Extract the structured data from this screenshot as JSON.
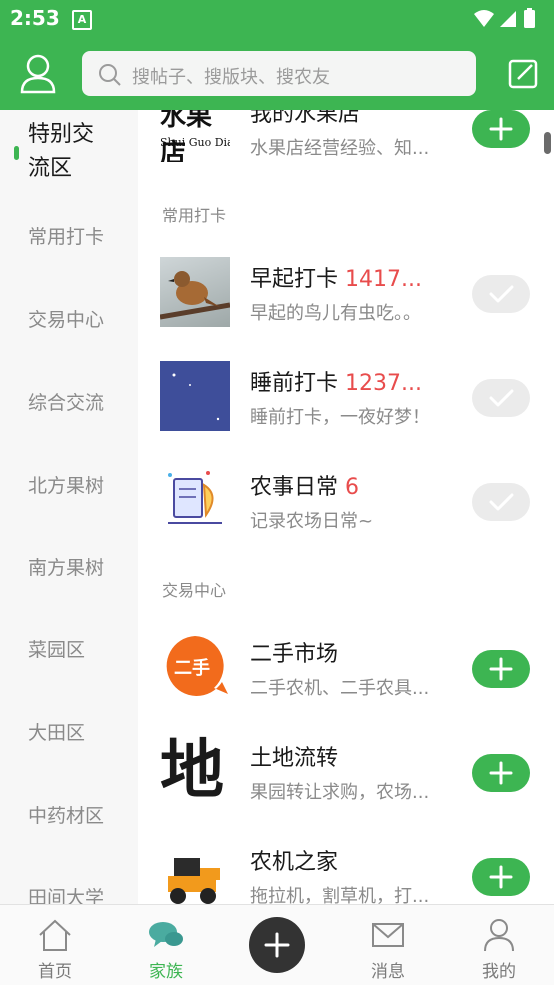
{
  "status_bar": {
    "time": "2:53",
    "notification_glyph": "A"
  },
  "search": {
    "placeholder": "搜帖子、搜版块、搜农友"
  },
  "sidebar": {
    "items": [
      {
        "label": "特别交\n流区",
        "active": true
      },
      {
        "label": "常用打卡"
      },
      {
        "label": "交易中心"
      },
      {
        "label": "综合交流"
      },
      {
        "label": "北方果树"
      },
      {
        "label": "南方果树"
      },
      {
        "label": "菜园区"
      },
      {
        "label": "大田区"
      },
      {
        "label": "中药材区"
      },
      {
        "label": "田间大学"
      }
    ]
  },
  "content": {
    "partial_top": {
      "title": "我的水果店",
      "desc": "水果店经营经验、知...",
      "thumb_text_cn": "水果店",
      "thumb_text_en": "Shui Guo Dian",
      "action": "add"
    },
    "sections": [
      {
        "header": "常用打卡",
        "items": [
          {
            "title": "早起打卡",
            "count": "1417...",
            "desc": "早起的鸟儿有虫吃。。",
            "action": "done"
          },
          {
            "title": "睡前打卡",
            "count": "1237...",
            "desc": "睡前打卡，一夜好梦！",
            "action": "done"
          },
          {
            "title": "农事日常",
            "count": "6",
            "desc": "记录农场日常~",
            "action": "done"
          }
        ]
      },
      {
        "header": "交易中心",
        "items": [
          {
            "title": "二手市场",
            "count": "",
            "desc": "二手农机、二手农具...",
            "thumb_text": "二手",
            "action": "add"
          },
          {
            "title": "土地流转",
            "count": "",
            "desc": "果园转让求购，农场...",
            "thumb_text": "地",
            "action": "add"
          },
          {
            "title": "农机之家",
            "count": "",
            "desc": "拖拉机，割草机，打...",
            "action": "add"
          }
        ]
      }
    ]
  },
  "tabbar": {
    "tabs": [
      {
        "label": "首页",
        "icon": "home-icon"
      },
      {
        "label": "家族",
        "icon": "chat-bubbles-icon",
        "active": true
      },
      {
        "label": "",
        "icon": "plus-icon"
      },
      {
        "label": "消息",
        "icon": "mail-icon"
      },
      {
        "label": "我的",
        "icon": "person-icon"
      }
    ]
  },
  "colors": {
    "brand_green": "#3db552",
    "count_red": "#e84c4c"
  }
}
